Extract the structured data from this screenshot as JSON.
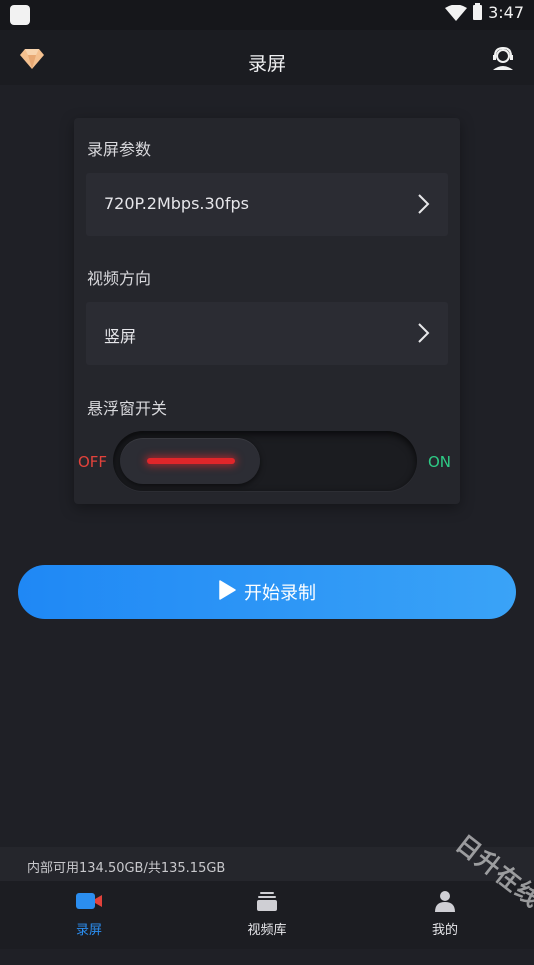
{
  "status_bar": {
    "time": "3:47"
  },
  "header": {
    "title": "录屏"
  },
  "settings": {
    "params_label": "录屏参数",
    "params_value": "720P.2Mbps.30fps",
    "orientation_label": "视频方向",
    "orientation_value": "竖屏",
    "float_label": "悬浮窗开关",
    "toggle_off_label": "OFF",
    "toggle_on_label": "ON",
    "float_enabled": false
  },
  "start_button": {
    "label": "开始录制"
  },
  "storage": {
    "text": "内部可用134.50GB/共135.15GB"
  },
  "nav": {
    "items": [
      {
        "label": "录屏",
        "icon": "camera-icon",
        "active": true
      },
      {
        "label": "视频库",
        "icon": "video-library-icon",
        "active": false
      },
      {
        "label": "我的",
        "icon": "profile-icon",
        "active": false
      }
    ]
  },
  "watermark": "日升在线",
  "colors": {
    "background": "#1f2026",
    "accent": "#2b8ef0",
    "off": "#e2423b",
    "on": "#2ecb86"
  }
}
